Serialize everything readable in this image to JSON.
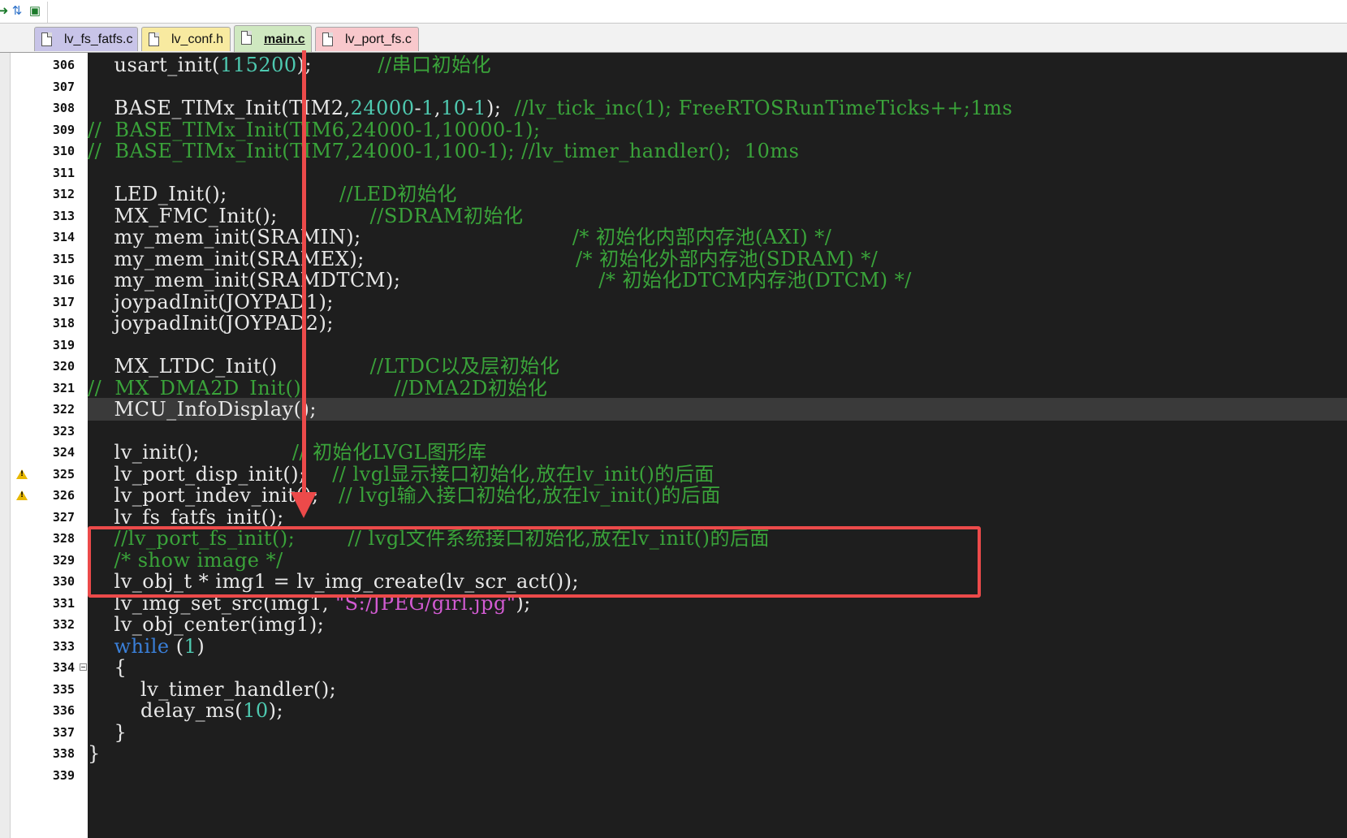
{
  "toolbar": {
    "icons": [
      "arrow-icon",
      "load-icon",
      "build-icon"
    ]
  },
  "tabs": [
    {
      "label": "lv_fs_fatfs.c",
      "color": "#c8c4e8",
      "active": false
    },
    {
      "label": "lv_conf.h",
      "color": "#f8eaa0",
      "active": false
    },
    {
      "label": "main.c",
      "color": "#cfe8c0",
      "active": true
    },
    {
      "label": "lv_port_fs.c",
      "color": "#f8c8cc",
      "active": false
    }
  ],
  "lines": [
    {
      "n": "306",
      "segs": [
        [
          "n",
          "    usart_init("
        ],
        [
          "num",
          "115200"
        ],
        [
          "n",
          ");          "
        ],
        [
          "com",
          "//串口初始化"
        ]
      ]
    },
    {
      "n": "307",
      "segs": []
    },
    {
      "n": "308",
      "segs": [
        [
          "n",
          "    BASE_TIMx_Init(TIM2,"
        ],
        [
          "num",
          "24000"
        ],
        [
          "n",
          "-"
        ],
        [
          "num",
          "1"
        ],
        [
          "n",
          ","
        ],
        [
          "num",
          "10"
        ],
        [
          "n",
          "-"
        ],
        [
          "num",
          "1"
        ],
        [
          "n",
          ");  "
        ],
        [
          "com",
          "//lv_tick_inc(1); FreeRTOSRunTimeTicks++;1ms"
        ]
      ]
    },
    {
      "n": "309",
      "segs": [
        [
          "com",
          "//  BASE_TIMx_Init(TIM6,24000-1,10000-1);"
        ]
      ]
    },
    {
      "n": "310",
      "segs": [
        [
          "com",
          "//  BASE_TIMx_Init(TIM7,24000-1,100-1); //lv_timer_handler();  10ms"
        ]
      ]
    },
    {
      "n": "311",
      "segs": []
    },
    {
      "n": "312",
      "segs": [
        [
          "n",
          "    LED_Init();                 "
        ],
        [
          "com",
          "//LED初始化"
        ]
      ]
    },
    {
      "n": "313",
      "segs": [
        [
          "n",
          "    MX_FMC_Init();              "
        ],
        [
          "com",
          "//SDRAM初始化"
        ]
      ]
    },
    {
      "n": "314",
      "segs": [
        [
          "n",
          "    my_mem_init(SRAMIN);                                "
        ],
        [
          "com",
          "/* 初始化内部内存池(AXI) */"
        ]
      ]
    },
    {
      "n": "315",
      "segs": [
        [
          "n",
          "    my_mem_init(SRAMEX);                                "
        ],
        [
          "com",
          "/* 初始化外部内存池(SDRAM) */"
        ]
      ]
    },
    {
      "n": "316",
      "segs": [
        [
          "n",
          "    my_mem_init(SRAMDTCM);                              "
        ],
        [
          "com",
          "/* 初始化DTCM内存池(DTCM) */"
        ]
      ]
    },
    {
      "n": "317",
      "segs": [
        [
          "n",
          "    joypadInit(JOYPAD1);"
        ]
      ]
    },
    {
      "n": "318",
      "segs": [
        [
          "n",
          "    joypadInit(JOYPAD2);"
        ]
      ]
    },
    {
      "n": "319",
      "segs": []
    },
    {
      "n": "320",
      "segs": [
        [
          "n",
          "    MX_LTDC_Init()              "
        ],
        [
          "com",
          "//LTDC以及层初始化"
        ]
      ]
    },
    {
      "n": "321",
      "segs": [
        [
          "com",
          "//  MX_DMA2D_Init();             //DMA2D初始化"
        ]
      ]
    },
    {
      "n": "322",
      "segs": [
        [
          "n",
          "    MCU_InfoDisplay();"
        ]
      ],
      "highlight": true
    },
    {
      "n": "323",
      "segs": []
    },
    {
      "n": "324",
      "segs": [
        [
          "n",
          "    lv_init();              "
        ],
        [
          "com",
          "// 初始化LVGL图形库"
        ]
      ]
    },
    {
      "n": "325",
      "segs": [
        [
          "n",
          "    lv_port_disp_init();    "
        ],
        [
          "com",
          "// lvgl显示接口初始化,放在lv_init()的后面"
        ]
      ],
      "warn": true
    },
    {
      "n": "326",
      "segs": [
        [
          "n",
          "    lv_port_indev_init();   "
        ],
        [
          "com",
          "// lvgl输入接口初始化,放在lv_init()的后面"
        ]
      ],
      "warn": true
    },
    {
      "n": "327",
      "segs": [
        [
          "n",
          "    lv_fs_fatfs_init();"
        ]
      ]
    },
    {
      "n": "328",
      "segs": [
        [
          "com",
          "    //lv_port_fs_init();        // lvgl文件系统接口初始化,放在lv_init()的后面"
        ]
      ]
    },
    {
      "n": "329",
      "segs": [
        [
          "com",
          "    /* show image */"
        ]
      ]
    },
    {
      "n": "330",
      "segs": [
        [
          "n",
          "    lv_obj_t * img1 = lv_img_create(lv_scr_act());"
        ]
      ]
    },
    {
      "n": "331",
      "segs": [
        [
          "n",
          "    lv_img_set_src(img1, "
        ],
        [
          "str",
          "\"S:/JPEG/girl.jpg\""
        ],
        [
          "n",
          ");"
        ]
      ]
    },
    {
      "n": "332",
      "segs": [
        [
          "n",
          "    lv_obj_center(img1);"
        ]
      ]
    },
    {
      "n": "333",
      "segs": [
        [
          "kw",
          "    while"
        ],
        [
          "n",
          " ("
        ],
        [
          "num",
          "1"
        ],
        [
          "n",
          ")"
        ]
      ]
    },
    {
      "n": "334",
      "segs": [
        [
          "n",
          "    {"
        ]
      ],
      "fold": true
    },
    {
      "n": "335",
      "segs": [
        [
          "n",
          "        lv_timer_handler();"
        ]
      ]
    },
    {
      "n": "336",
      "segs": [
        [
          "n",
          "        delay_ms("
        ],
        [
          "num",
          "10"
        ],
        [
          "n",
          ");"
        ]
      ]
    },
    {
      "n": "337",
      "segs": [
        [
          "n",
          "    }"
        ]
      ]
    },
    {
      "n": "338",
      "segs": [
        [
          "n",
          "}"
        ]
      ]
    },
    {
      "n": "339",
      "segs": []
    }
  ]
}
